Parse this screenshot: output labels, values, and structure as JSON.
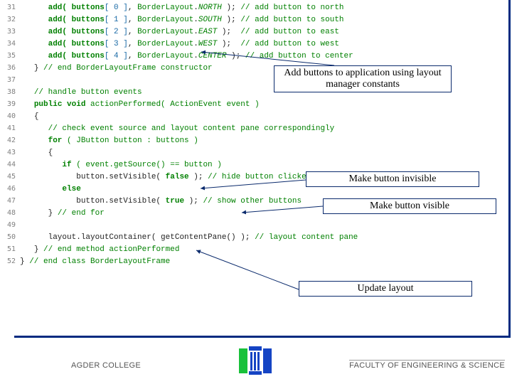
{
  "code": {
    "first_lineno": 31,
    "lines": [
      [
        [
          "      ",
          "plain"
        ],
        [
          "add( buttons",
          "kw"
        ],
        [
          "[",
          "brk"
        ],
        [
          " 0 ",
          "num"
        ],
        [
          "]",
          "brk"
        ],
        [
          ", ",
          "punc"
        ],
        [
          "BorderLayout",
          "type"
        ],
        [
          ".",
          "punc"
        ],
        [
          "NORTH ",
          "const"
        ],
        [
          "); ",
          "punc"
        ],
        [
          "// add button to north",
          "comment"
        ]
      ],
      [
        [
          "      ",
          "plain"
        ],
        [
          "add( buttons",
          "kw"
        ],
        [
          "[",
          "brk"
        ],
        [
          " 1 ",
          "num"
        ],
        [
          "]",
          "brk"
        ],
        [
          ", ",
          "punc"
        ],
        [
          "BorderLayout",
          "type"
        ],
        [
          ".",
          "punc"
        ],
        [
          "SOUTH ",
          "const"
        ],
        [
          "); ",
          "punc"
        ],
        [
          "// add button to south",
          "comment"
        ]
      ],
      [
        [
          "      ",
          "plain"
        ],
        [
          "add( buttons",
          "kw"
        ],
        [
          "[",
          "brk"
        ],
        [
          " 2 ",
          "num"
        ],
        [
          "]",
          "brk"
        ],
        [
          ", ",
          "punc"
        ],
        [
          "BorderLayout",
          "type"
        ],
        [
          ".",
          "punc"
        ],
        [
          "EAST ",
          "const"
        ],
        [
          ");  ",
          "punc"
        ],
        [
          "// add button to east",
          "comment"
        ]
      ],
      [
        [
          "      ",
          "plain"
        ],
        [
          "add( buttons",
          "kw"
        ],
        [
          "[",
          "brk"
        ],
        [
          " 3 ",
          "num"
        ],
        [
          "]",
          "brk"
        ],
        [
          ", ",
          "punc"
        ],
        [
          "BorderLayout",
          "type"
        ],
        [
          ".",
          "punc"
        ],
        [
          "WEST ",
          "const"
        ],
        [
          ");  ",
          "punc"
        ],
        [
          "// add button to west",
          "comment"
        ]
      ],
      [
        [
          "      ",
          "plain"
        ],
        [
          "add( buttons",
          "kw"
        ],
        [
          "[",
          "brk"
        ],
        [
          " 4 ",
          "num"
        ],
        [
          "]",
          "brk"
        ],
        [
          ", ",
          "punc"
        ],
        [
          "BorderLayout",
          "type"
        ],
        [
          ".",
          "punc"
        ],
        [
          "CENTER ",
          "const"
        ],
        [
          "); ",
          "punc"
        ],
        [
          "// add button to center",
          "comment"
        ]
      ],
      [
        [
          "   ",
          "plain"
        ],
        [
          "} ",
          "punc"
        ],
        [
          "// end BorderLayoutFrame constructor",
          "comment"
        ]
      ],
      [
        [
          "",
          "plain"
        ]
      ],
      [
        [
          "   ",
          "plain"
        ],
        [
          "// handle button events",
          "comment"
        ]
      ],
      [
        [
          "   ",
          "plain"
        ],
        [
          "public void",
          "kw"
        ],
        [
          " actionPerformed( ActionEvent event )",
          "type"
        ]
      ],
      [
        [
          "   ",
          "plain"
        ],
        [
          "{",
          "punc"
        ]
      ],
      [
        [
          "      ",
          "plain"
        ],
        [
          "// check event source and layout content pane correspondingly",
          "comment"
        ]
      ],
      [
        [
          "      ",
          "plain"
        ],
        [
          "for",
          "kw"
        ],
        [
          " ( JButton button : buttons )",
          "type"
        ]
      ],
      [
        [
          "      ",
          "plain"
        ],
        [
          "{",
          "punc"
        ]
      ],
      [
        [
          "         ",
          "plain"
        ],
        [
          "if",
          "kw"
        ],
        [
          " ( event.getSource() == button )",
          "type"
        ]
      ],
      [
        [
          "            ",
          "plain"
        ],
        [
          "button.setVisible( ",
          "plain"
        ],
        [
          "false",
          "kw"
        ],
        [
          " ); ",
          "plain"
        ],
        [
          "// hide button clicked",
          "comment"
        ]
      ],
      [
        [
          "         ",
          "plain"
        ],
        [
          "else",
          "kw"
        ]
      ],
      [
        [
          "            ",
          "plain"
        ],
        [
          "button.setVisible( ",
          "plain"
        ],
        [
          "true",
          "kw"
        ],
        [
          " ); ",
          "plain"
        ],
        [
          "// show other buttons",
          "comment"
        ]
      ],
      [
        [
          "      ",
          "plain"
        ],
        [
          "} ",
          "punc"
        ],
        [
          "// end for",
          "comment"
        ]
      ],
      [
        [
          "",
          "plain"
        ]
      ],
      [
        [
          "      ",
          "plain"
        ],
        [
          "layout.layoutContainer( getContentPane() ); ",
          "plain"
        ],
        [
          "// layout content pane",
          "comment"
        ]
      ],
      [
        [
          "   ",
          "plain"
        ],
        [
          "} ",
          "punc"
        ],
        [
          "// end method actionPerformed",
          "comment"
        ]
      ],
      [
        [
          "} ",
          "punc"
        ],
        [
          "// end class BorderLayoutFrame",
          "comment"
        ]
      ]
    ]
  },
  "callouts": {
    "c1": "Add buttons to application using layout manager constants",
    "c2": "Make button invisible",
    "c3": "Make button visible",
    "c4": "Update layout"
  },
  "footer": {
    "left": "AGDER COLLEGE",
    "right": "FACULTY OF ENGINEERING & SCIENCE"
  }
}
